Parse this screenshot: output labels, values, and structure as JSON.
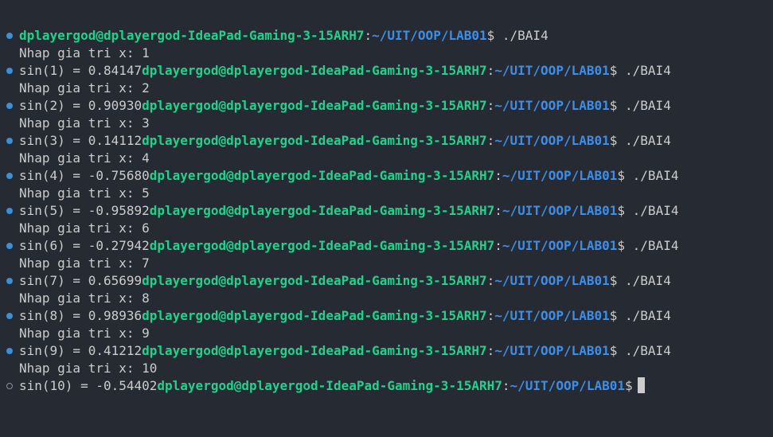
{
  "prompt": {
    "user_host": "dplayergod@dplayergod-IdeaPad-Gaming-3-15ARH7",
    "separator": ":",
    "path": "~/UIT/OOP/LAB01",
    "symbol": "$"
  },
  "command": " ./BAI4",
  "lines": [
    {
      "marker": "ok",
      "output": "",
      "prompt": true,
      "command": true
    },
    {
      "marker": "none",
      "output": "Nhap gia tri x: 1",
      "prompt": false
    },
    {
      "marker": "ok",
      "output": "sin(1) = 0.84147",
      "prompt": true,
      "command": true
    },
    {
      "marker": "none",
      "output": "Nhap gia tri x: 2",
      "prompt": false
    },
    {
      "marker": "ok",
      "output": "sin(2) = 0.90930",
      "prompt": true,
      "command": true
    },
    {
      "marker": "none",
      "output": "Nhap gia tri x: 3",
      "prompt": false
    },
    {
      "marker": "ok",
      "output": "sin(3) = 0.14112",
      "prompt": true,
      "command": true
    },
    {
      "marker": "none",
      "output": "Nhap gia tri x: 4",
      "prompt": false
    },
    {
      "marker": "ok",
      "output": "sin(4) = -0.75680",
      "prompt": true,
      "command": true
    },
    {
      "marker": "none",
      "output": "Nhap gia tri x: 5",
      "prompt": false
    },
    {
      "marker": "ok",
      "output": "sin(5) = -0.95892",
      "prompt": true,
      "command": true
    },
    {
      "marker": "none",
      "output": "Nhap gia tri x: 6",
      "prompt": false
    },
    {
      "marker": "ok",
      "output": "sin(6) = -0.27942",
      "prompt": true,
      "command": true
    },
    {
      "marker": "none",
      "output": "Nhap gia tri x: 7",
      "prompt": false
    },
    {
      "marker": "ok",
      "output": "sin(7) = 0.65699",
      "prompt": true,
      "command": true
    },
    {
      "marker": "none",
      "output": "Nhap gia tri x: 8",
      "prompt": false
    },
    {
      "marker": "ok",
      "output": "sin(8) = 0.98936",
      "prompt": true,
      "command": true
    },
    {
      "marker": "none",
      "output": "Nhap gia tri x: 9",
      "prompt": false
    },
    {
      "marker": "ok",
      "output": "sin(9) = 0.41212",
      "prompt": true,
      "command": true
    },
    {
      "marker": "none",
      "output": "Nhap gia tri x: 10",
      "prompt": false
    },
    {
      "marker": "pending",
      "output": "sin(10) = -0.54402",
      "prompt": true,
      "command": false,
      "cursor": true
    }
  ],
  "colors": {
    "background": "#262a33",
    "user_host": "#23d18b",
    "path": "#3b8eea",
    "text": "#cccccc",
    "marker_ok": "#3a8fd6"
  }
}
